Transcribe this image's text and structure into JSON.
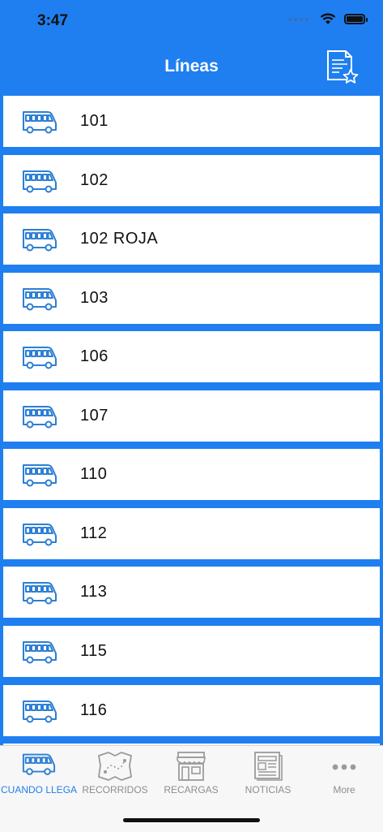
{
  "status_bar": {
    "time": "3:47"
  },
  "nav": {
    "title": "Líneas",
    "favorites_icon": "document-star-icon"
  },
  "lines": [
    {
      "label": "101"
    },
    {
      "label": "102"
    },
    {
      "label": "102 ROJA"
    },
    {
      "label": "103"
    },
    {
      "label": "106"
    },
    {
      "label": "107"
    },
    {
      "label": "110"
    },
    {
      "label": "112"
    },
    {
      "label": "113"
    },
    {
      "label": "115"
    },
    {
      "label": "116"
    }
  ],
  "tabs": [
    {
      "label": "CUANDO LLEGA",
      "icon": "bus-icon",
      "active": true
    },
    {
      "label": "RECORRIDOS",
      "icon": "map-icon",
      "active": false
    },
    {
      "label": "RECARGAS",
      "icon": "store-icon",
      "active": false
    },
    {
      "label": "NOTICIAS",
      "icon": "newspaper-icon",
      "active": false
    },
    {
      "label": "More",
      "icon": "more-icon",
      "active": false
    }
  ],
  "colors": {
    "accent": "#1f7ff0",
    "icon_blue": "#2d7fd3",
    "tab_inactive": "#8e8e93"
  }
}
